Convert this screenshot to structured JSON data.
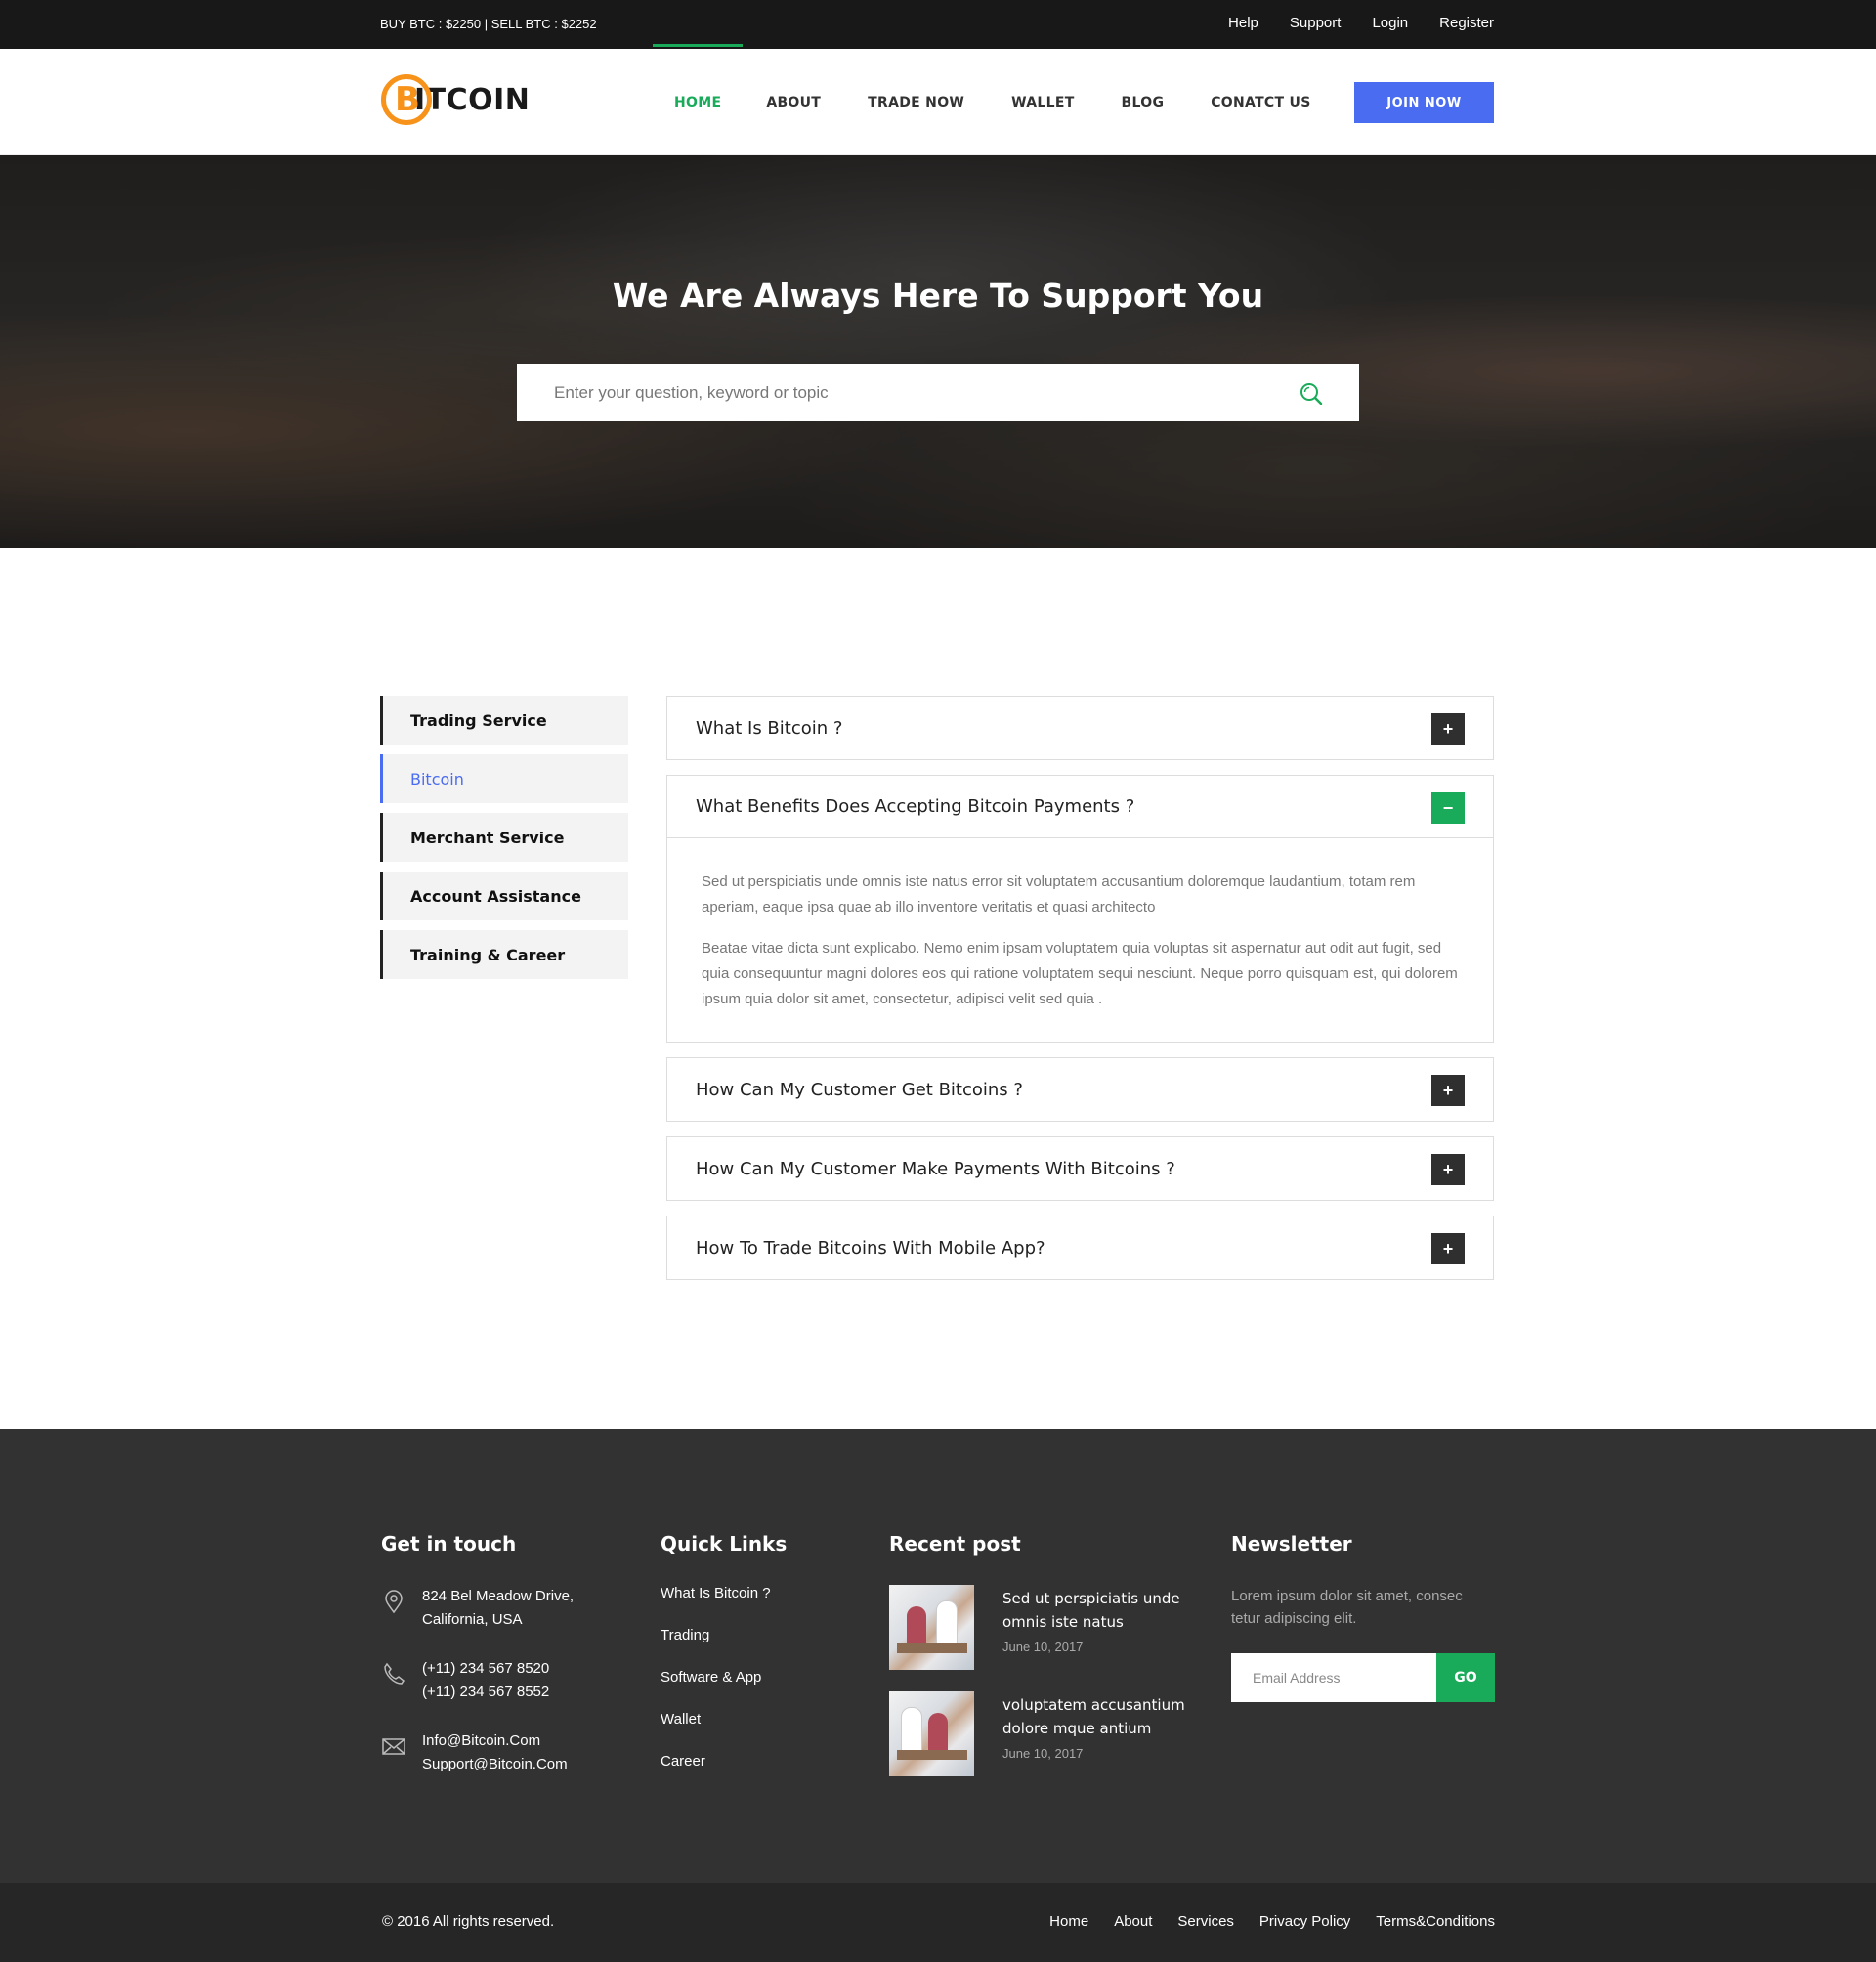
{
  "topbar": {
    "rates": "BUY BTC : $2250  |  SELL BTC : $2252",
    "links": [
      "Help",
      "Support",
      "Login",
      "Register"
    ]
  },
  "header": {
    "logo_mark": "B",
    "logo_text": "ITCOIN",
    "nav": [
      "HOME",
      "ABOUT",
      "TRADE NOW",
      "WALLET",
      "BLOG",
      "CONATCT US"
    ],
    "join_label": "JOIN NOW",
    "colors": {
      "accent_green": "#1aab5a",
      "accent_blue": "#4a6cf0",
      "logo_orange": "#f7931a"
    }
  },
  "hero": {
    "title": "We Are Always Here To Support You",
    "search_placeholder": "Enter your question, keyword or topic",
    "search_icon": "search-icon"
  },
  "sidebar": {
    "items": [
      "Trading Service",
      "Bitcoin",
      "Merchant Service",
      "Account Assistance",
      "Training & Career"
    ],
    "active": "Bitcoin"
  },
  "faq": {
    "items": [
      {
        "question": "What Is Bitcoin ?",
        "toggle": "+"
      },
      {
        "question": "What Benefits Does Accepting Bitcoin Payments ?",
        "toggle": "−",
        "answer": [
          "Sed ut perspiciatis unde omnis iste natus error sit voluptatem accusantium doloremque laudantium, totam rem aperiam, eaque ipsa quae ab illo inventore veritatis et quasi architecto",
          "Beatae vitae dicta sunt explicabo. Nemo enim ipsam voluptatem quia voluptas sit aspernatur aut odit aut fugit, sed quia consequuntur magni dolores eos qui ratione voluptatem sequi nesciunt. Neque porro quisquam est, qui dolorem ipsum quia dolor sit amet, consectetur, adipisci velit sed quia ."
        ]
      },
      {
        "question": "How Can My Customer Get Bitcoins ?",
        "toggle": "+"
      },
      {
        "question": "How Can My Customer Make Payments With Bitcoins ?",
        "toggle": "+"
      },
      {
        "question": "How To Trade Bitcoins With Mobile App?",
        "toggle": "+"
      }
    ]
  },
  "footer": {
    "contact": {
      "title": "Get in touch",
      "address": [
        "824 Bel Meadow Drive,",
        "California, USA"
      ],
      "phones": [
        "(+11) 234 567 8520",
        "(+11) 234 567 8552"
      ],
      "emails": [
        "Info@Bitcoin.Com",
        "Support@Bitcoin.Com"
      ]
    },
    "quick_links": {
      "title": "Quick Links",
      "items": [
        "What Is Bitcoin ?",
        "Trading",
        "Software & App",
        "Wallet",
        "Career"
      ]
    },
    "recent": {
      "title": "Recent post",
      "posts": [
        {
          "title": "Sed ut perspiciatis unde omnis iste natus",
          "date": "June 10, 2017"
        },
        {
          "title": "voluptatem accusantium dolore mque antium",
          "date": "June 10, 2017"
        }
      ]
    },
    "newsletter": {
      "title": "Newsletter",
      "text": "Lorem ipsum dolor sit amet, consec tetur adipiscing elit.",
      "placeholder": "Email Address",
      "button": "GO"
    }
  },
  "bottom": {
    "copyright": "© 2016 All rights reserved.",
    "links": [
      "Home",
      "About",
      "Services",
      "Privacy Policy",
      "Terms&Conditions"
    ]
  }
}
